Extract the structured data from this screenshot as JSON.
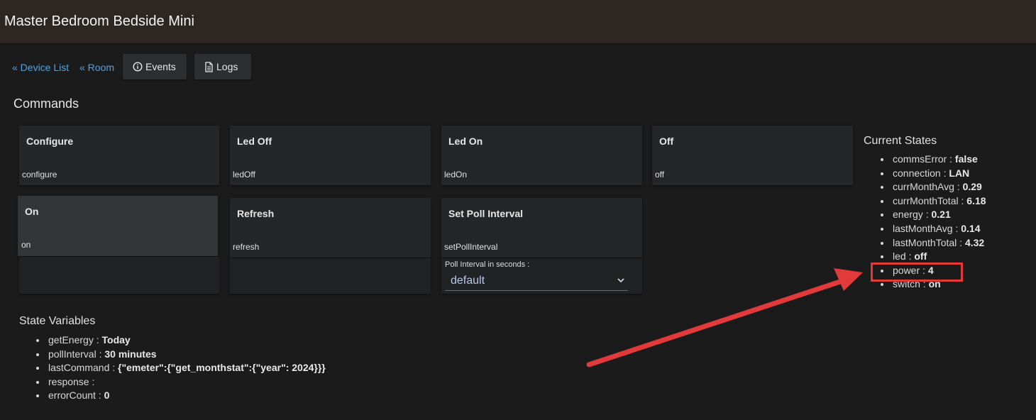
{
  "header": {
    "title": "Master Bedroom Bedside Mini"
  },
  "nav": {
    "device_list": "« Device List",
    "room": "« Room",
    "events": "Events",
    "logs": "Logs"
  },
  "commands": {
    "title": "Commands",
    "items": [
      {
        "name": "Configure",
        "command": "configure"
      },
      {
        "name": "Led Off",
        "command": "ledOff"
      },
      {
        "name": "Led On",
        "command": "ledOn"
      },
      {
        "name": "Off",
        "command": "off"
      },
      {
        "name": "On",
        "command": "on"
      },
      {
        "name": "Refresh",
        "command": "refresh"
      },
      {
        "name": "Set Poll Interval",
        "command": "setPollInterval"
      }
    ],
    "poll_param": {
      "label": "Poll Interval in seconds :",
      "value": "default"
    }
  },
  "current_states": {
    "title": "Current States",
    "items": [
      {
        "key": "commsError",
        "value": "false"
      },
      {
        "key": "connection",
        "value": "LAN"
      },
      {
        "key": "currMonthAvg",
        "value": "0.29"
      },
      {
        "key": "currMonthTotal",
        "value": "6.18"
      },
      {
        "key": "energy",
        "value": "0.21"
      },
      {
        "key": "lastMonthAvg",
        "value": "0.14"
      },
      {
        "key": "lastMonthTotal",
        "value": "4.32"
      },
      {
        "key": "led",
        "value": "off"
      },
      {
        "key": "power",
        "value": "4"
      },
      {
        "key": "switch",
        "value": "on"
      }
    ]
  },
  "state_variables": {
    "title": "State Variables",
    "items": [
      {
        "key": "getEnergy",
        "value": "Today"
      },
      {
        "key": "pollInterval",
        "value": "30 minutes"
      },
      {
        "key": "lastCommand",
        "value": "{\"emeter\":{\"get_monthstat\":{\"year\": 2024}}}"
      },
      {
        "key": "response",
        "value": ""
      },
      {
        "key": "errorCount",
        "value": "0"
      }
    ]
  },
  "colors": {
    "accent_link": "#4fa3e0",
    "annotation": "#e23a3a",
    "header_bg": "#2e2622"
  },
  "icons": {
    "events": "info-circle-icon",
    "logs": "document-icon",
    "select": "chevron-down-icon"
  }
}
